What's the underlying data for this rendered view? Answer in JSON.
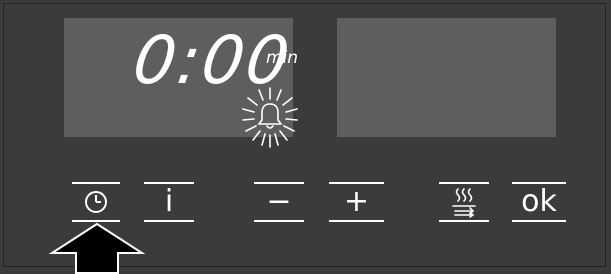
{
  "display": {
    "time": "0:00",
    "unit": "min",
    "alarm_icon": "bell-icon (blinking)"
  },
  "buttons": {
    "clock": {
      "icon": "clock-icon"
    },
    "info": {
      "label": "i"
    },
    "minus": {
      "label": "−"
    },
    "plus": {
      "label": "+"
    },
    "steam": {
      "icon": "steam-icon"
    },
    "ok": {
      "label": "ok"
    }
  },
  "pointer": {
    "icon": "up-arrow-icon",
    "target": "clock"
  },
  "colors": {
    "panel": "#3b3b3b",
    "screen": "#5e5e5e",
    "text": "#ffffff",
    "arrow_fill": "#000000"
  }
}
